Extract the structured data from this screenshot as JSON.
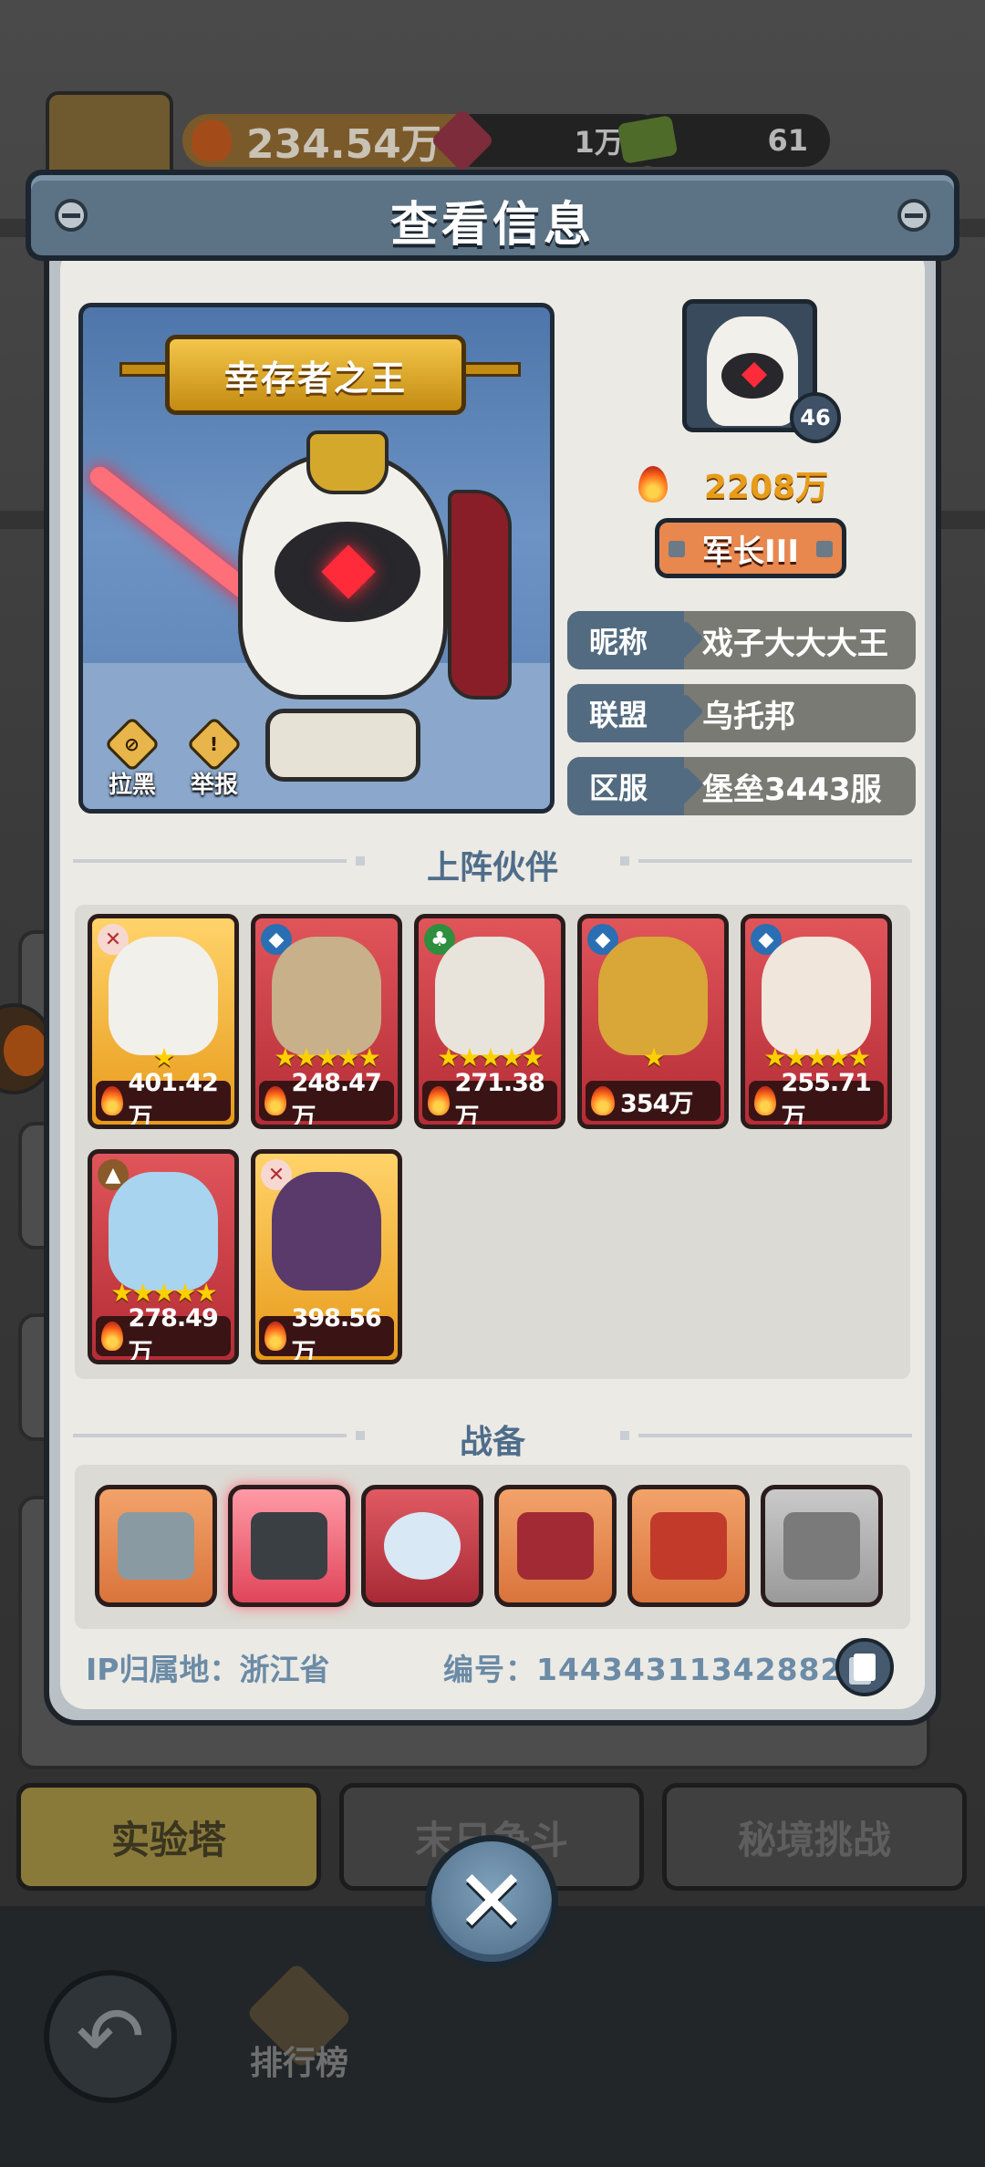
{
  "background": {
    "top_power": "234.54万",
    "top_gem": "1万1",
    "top_cash": "61",
    "tabs": [
      "实验塔",
      "末日争斗",
      "秘境挑战"
    ],
    "leaderboard_label": "排行榜"
  },
  "modal": {
    "title": "查看信息",
    "hero_title": "幸存者之王",
    "actions": {
      "block": "拉黑",
      "report": "举报"
    },
    "level": "46",
    "power": "2208万",
    "rank": "军长III",
    "info": [
      {
        "key": "昵称",
        "value": "戏子大大大王"
      },
      {
        "key": "联盟",
        "value": "乌托邦"
      },
      {
        "key": "区服",
        "value": "堡垒3443服"
      }
    ],
    "partners_title": "上阵伙伴",
    "partners": [
      {
        "power": "401.42万",
        "stars": "★",
        "type": "sword"
      },
      {
        "power": "248.47万",
        "stars": "★★★★★",
        "type": "shield"
      },
      {
        "power": "271.38万",
        "stars": "★★★★★",
        "type": "clover"
      },
      {
        "power": "354万",
        "stars": "★",
        "type": "shield"
      },
      {
        "power": "255.71万",
        "stars": "★★★★★",
        "type": "shield"
      },
      {
        "power": "278.49万",
        "stars": "★★★★★",
        "type": "tank"
      },
      {
        "power": "398.56万",
        "stars": "",
        "type": "sword"
      }
    ],
    "equip_title": "战备",
    "ip_location": "IP归属地：浙江省",
    "player_id": "编号：14434311342882"
  },
  "colors": {
    "accent_blue": "#4e6d8a",
    "power_orange": "#e79c1a",
    "rank_orange": "#e8874e"
  }
}
